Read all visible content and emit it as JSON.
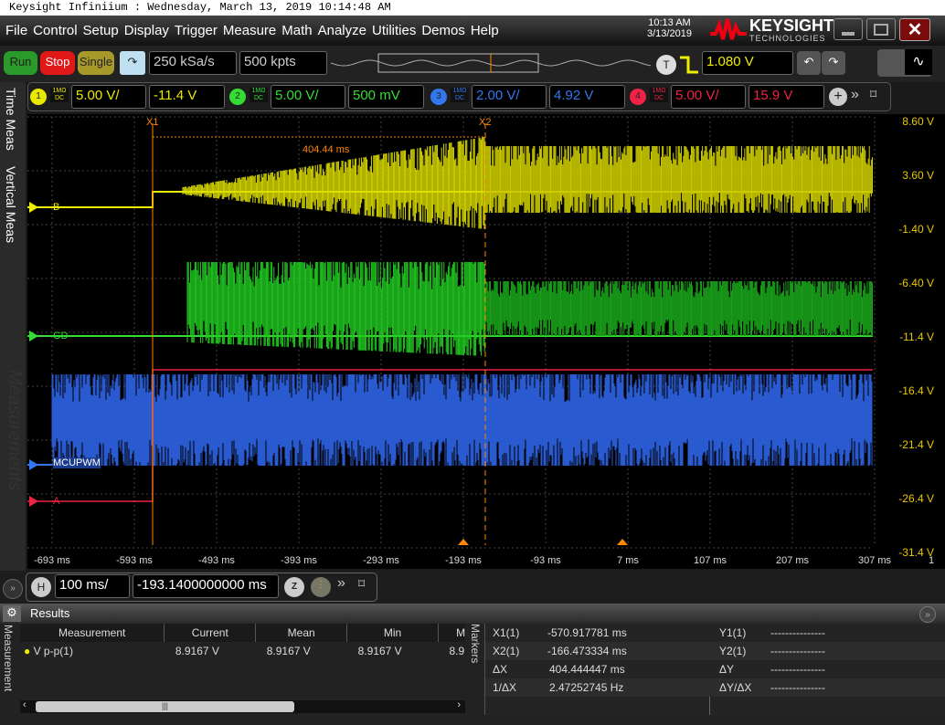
{
  "title_bar": "Keysight Infiniium : Wednesday, March 13, 2019 10:14:48 AM",
  "menu": [
    "File",
    "Control",
    "Setup",
    "Display",
    "Trigger",
    "Measure",
    "Math",
    "Analyze",
    "Utilities",
    "Demos",
    "Help"
  ],
  "clock": {
    "time": "10:13 AM",
    "date": "3/13/2019"
  },
  "brand": {
    "name": "KEYSIGHT",
    "sub": "TECHNOLOGIES"
  },
  "acq": {
    "run": "Run",
    "stop": "Stop",
    "single": "Single",
    "sample_rate": "250 kSa/s",
    "memory": "500 kpts"
  },
  "trigger": {
    "label": "T",
    "level": "1.080 V"
  },
  "channels": [
    {
      "num": "1",
      "coupling": "1MΩ",
      "dc": "DC",
      "scale": "5.00 V/",
      "offset": "-11.4 V",
      "color": "#e8e800"
    },
    {
      "num": "2",
      "coupling": "1MΩ",
      "dc": "DC",
      "scale": "5.00 V/",
      "offset": "500 mV",
      "color": "#33dd33"
    },
    {
      "num": "3",
      "coupling": "1MΩ",
      "dc": "DC",
      "scale": "2.00 V/",
      "offset": "4.92 V",
      "color": "#3377ee"
    },
    {
      "num": "4",
      "coupling": "1MΩ",
      "dc": "DC",
      "scale": "5.00 V/",
      "offset": "15.9 V",
      "color": "#ee2244"
    }
  ],
  "side_tabs": {
    "time": "Time Meas",
    "vertical": "Vertical Meas",
    "measurements": "Measurements"
  },
  "waveform_labels": {
    "ch1": "B",
    "ch2": "GD",
    "ch3": "MCUPWM",
    "ch4": "A"
  },
  "markers": {
    "x1_label": "X1",
    "x2_label": "X2",
    "delta_label": "404.44 ms"
  },
  "y_ticks": [
    "8.60 V",
    "3.60 V",
    "-1.40 V",
    "-6.40 V",
    "-11.4 V",
    "-16.4 V",
    "-21.4 V",
    "-26.4 V",
    "-31.4 V"
  ],
  "x_ticks": [
    "-693 ms",
    "-593 ms",
    "-493 ms",
    "-393 ms",
    "-293 ms",
    "-193 ms",
    "-93 ms",
    "7 ms",
    "107 ms",
    "207 ms",
    "307 ms"
  ],
  "x_tick_extra": "1",
  "horizontal": {
    "label": "H",
    "scale": "100 ms/",
    "position": "-193.1400000000 ms",
    "zoom": "Z"
  },
  "results": {
    "title": "Results",
    "side_label": "Measurement",
    "markers_side": "Markers",
    "headers": [
      "Measurement",
      "Current",
      "Mean",
      "Min",
      "Max"
    ],
    "rows": [
      {
        "name": "V p-p(1)",
        "current": "8.9167 V",
        "mean": "8.9167 V",
        "min": "8.9167 V",
        "max": "8.9"
      }
    ],
    "marker_rows": [
      {
        "l": "X1(1)",
        "v": "-570.917781 ms",
        "r": "Y1(1)",
        "rv": "---------------"
      },
      {
        "l": "X2(1)",
        "v": "-166.473334 ms",
        "r": "Y2(1)",
        "rv": "---------------"
      },
      {
        "l": "ΔX",
        "v": "404.444447 ms",
        "r": "ΔY",
        "rv": "---------------"
      },
      {
        "l": "1/ΔX",
        "v": "2.47252745 Hz",
        "r": "ΔY/ΔX",
        "rv": "---------------"
      }
    ]
  }
}
